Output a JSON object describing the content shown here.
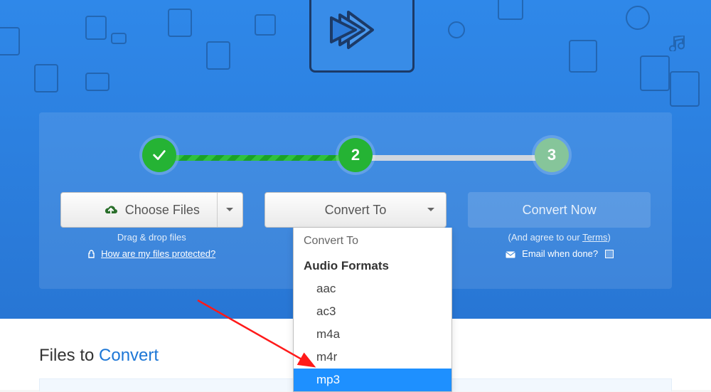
{
  "steps": {
    "step2_label": "2",
    "step3_label": "3"
  },
  "choose": {
    "label": "Choose Files",
    "dragdrop": "Drag & drop files",
    "protected": "How are my files protected?"
  },
  "convert": {
    "button_label": "Convert To",
    "dd_title": "Convert To",
    "dd_group": "Audio Formats",
    "options": {
      "o1": "aac",
      "o2": "ac3",
      "o3": "m4a",
      "o4": "m4r",
      "o5": "mp3"
    }
  },
  "now": {
    "label": "Convert Now",
    "agree_pre": "(And agree to our ",
    "agree_link": "Terms",
    "agree_post": ")",
    "email_label": "Email when done?"
  },
  "files_section": {
    "pre": "Files to ",
    "accent": "Convert"
  }
}
